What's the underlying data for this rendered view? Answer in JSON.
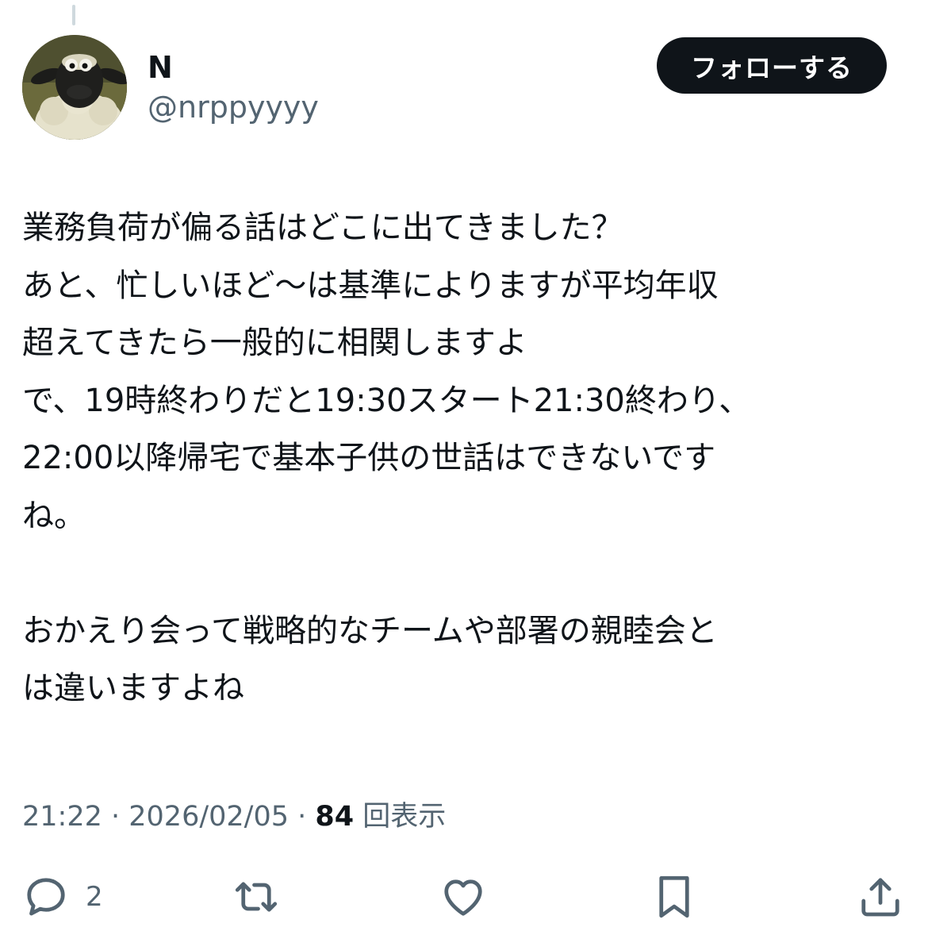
{
  "author": {
    "display_name": "N",
    "handle": "@nrppyyyy",
    "avatar_icon": "sheep-avatar"
  },
  "follow_button": {
    "label": "フォローする"
  },
  "tweet": {
    "lines": [
      "業務負荷が偏る話はどこに出てきました？",
      "あと、忙しいほど〜は基準によりますが平均年収",
      "超えてきたら一般的に相関しますよ",
      "で、19時終わりだと19:30スタート21:30終わり、",
      "22:00以降帰宅で基本子供の世話はできないです",
      "ね。",
      "",
      "おかえり会って戦略的なチームや部署の親睦会と",
      "は違いますよね"
    ]
  },
  "meta": {
    "time": "21:22",
    "date": "2026/02/05",
    "separator": " · ",
    "views_count": "84",
    "views_label": " 回表示"
  },
  "actions": {
    "reply": {
      "icon": "reply-icon",
      "count": "2"
    },
    "retweet": {
      "icon": "retweet-icon"
    },
    "like": {
      "icon": "heart-icon"
    },
    "bookmark": {
      "icon": "bookmark-icon"
    },
    "share": {
      "icon": "share-icon"
    }
  },
  "colors": {
    "text": "#0f1419",
    "secondary": "#536471",
    "button_bg": "#0f1419",
    "thread_line": "#cfd9de"
  }
}
